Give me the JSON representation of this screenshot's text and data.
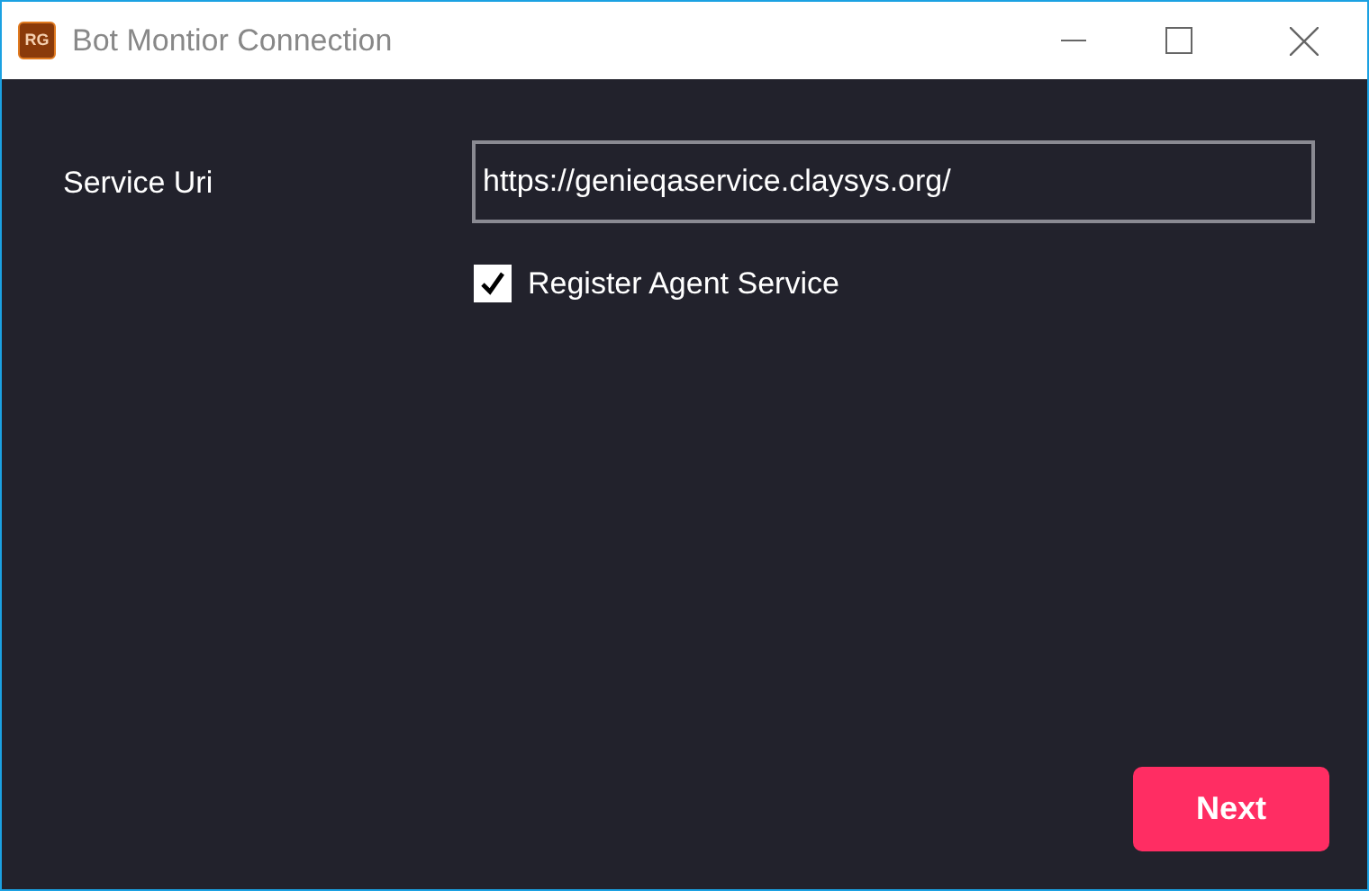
{
  "window": {
    "icon_text": "RG",
    "title": "Bot Montior Connection"
  },
  "form": {
    "service_uri": {
      "label": "Service Uri",
      "value": "https://genieqaservice.claysys.org/"
    },
    "register": {
      "label": "Register Agent Service",
      "checked": true
    }
  },
  "buttons": [
    {
      "label": "Next"
    }
  ]
}
